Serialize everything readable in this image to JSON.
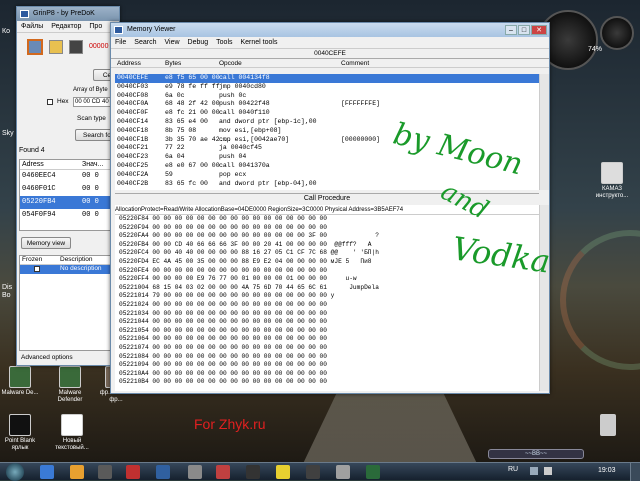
{
  "cheatengine": {
    "title": "GrinP8 - by PreDoK",
    "menu": [
      "Файлы",
      "Редактор",
      "Про"
    ],
    "value_placeholder": "00000",
    "array_label": "Array of Byte",
    "hex_label": "Hex",
    "hex_value": "00 00 CD 40",
    "scan_type_label": "Scan type",
    "found_label": "Found 4",
    "search_btn": "Search for",
    "first_btn": "Ce",
    "addr_col": "Adress",
    "val_col": "Знач...",
    "results": [
      {
        "addr": "0460EEC4",
        "val": "00 0"
      },
      {
        "addr": "0460F01C",
        "val": "00 0"
      },
      {
        "addr": "05220FB4",
        "val": "00 0"
      },
      {
        "addr": "054F0F94",
        "val": "00 0"
      }
    ],
    "memview_btn": "Memory view",
    "table_col1": "Frozen",
    "table_col2": "Description",
    "table_desc": "No description",
    "advanced": "Advanced options"
  },
  "memview": {
    "title": "Memory Viewer",
    "menu": [
      "File",
      "Search",
      "View",
      "Debug",
      "Tools",
      "Kernel tools"
    ],
    "addrbar": "0040CEFE",
    "cols": [
      "Address",
      "Bytes",
      "Opcode",
      "Comment"
    ],
    "rows": [
      {
        "a": "0040CEFE",
        "b": "e8 f5 65 00 00",
        "o": "call 004134f8",
        "c": ""
      },
      {
        "a": "0040CF03",
        "b": "e9 78 fe ff ff",
        "o": "jmp 0040cd80",
        "c": ""
      },
      {
        "a": "0040CF08",
        "b": "6a 0c",
        "o": "push 0c",
        "c": ""
      },
      {
        "a": "0040CF0A",
        "b": "68 48 2f 42 00",
        "o": "push 00422f48",
        "c": "[FFFFFFFE]"
      },
      {
        "a": "0040CF0F",
        "b": "e8 fc 21 00 00",
        "o": "call 0040f110",
        "c": ""
      },
      {
        "a": "0040CF14",
        "b": "83 65 e4 00",
        "o": "and dword ptr [ebp-1c],00",
        "c": ""
      },
      {
        "a": "0040CF18",
        "b": "8b 75 08",
        "o": "mov esi,[ebp+08]",
        "c": ""
      },
      {
        "a": "0040CF1B",
        "b": "3b 35 70 ae 42...",
        "o": "cmp esi,[0042ae70]",
        "c": "[00000000]"
      },
      {
        "a": "0040CF21",
        "b": "77 22",
        "o": "ja 0040cf45",
        "c": ""
      },
      {
        "a": "0040CF23",
        "b": "6a 04",
        "o": "push 04",
        "c": ""
      },
      {
        "a": "0040CF25",
        "b": "e8 e0 67 00 00",
        "o": "call 0041370a",
        "c": ""
      },
      {
        "a": "0040CF2A",
        "b": "59",
        "o": "pop ecx",
        "c": ""
      },
      {
        "a": "0040CF2B",
        "b": "83 65 fc 00",
        "o": "and dword ptr [ebp-04],00",
        "c": ""
      }
    ],
    "callproc": "Call Procedure",
    "hexinfo": "AllocationProtect=Read/Write AllocationBase=04DE0000 RegionSize=3C0000 Physical Address=3B5AEF74",
    "hexrows": [
      "05220F84 00 00 00 00 00 00 00 00 00 00 00 00 00 00 00 00",
      "05220F94 00 00 00 00 00 00 00 00 00 00 00 00 00 00 00 00",
      "05220FA4 00 00 00 00 00 00 00 00 00 00 00 00 00 00 3F 00             ?",
      "05220FB4 00 00 CD 40 66 66 66 3F 00 00 20 41 00 00 00 00  @@fff?   A",
      "05220FC4 00 00 40 40 00 00 00 00 88 16 27 05 C1 CF 7C 68 @@    ' 'БП|h",
      "05220FD4 EC 4A 45 00 35 00 00 00 88 E9 E2 04 00 00 00 00 мJE 5   Пи8",
      "05220FE4 00 00 00 00 00 00 00 00 00 00 00 00 00 00 00 00",
      "05220FF4 00 00 00 00 E9 76 77 00 01 00 00 00 01 00 00 00     u-w",
      "05221004 68 15 04 03 02 00 00 00 4A 75 6D 70 44 65 6C 61      JumpDela",
      "05221014 79 00 00 00 00 00 00 00 00 00 00 00 00 00 00 00 y",
      "05221024 00 00 00 00 00 00 00 00 00 00 00 00 00 00 00 00",
      "05221034 00 00 00 00 00 00 00 00 00 00 00 00 00 00 00 00",
      "05221044 00 00 00 00 00 00 00 00 00 00 00 00 00 00 00 00",
      "05221054 00 00 00 00 00 00 00 00 00 00 00 00 00 00 00 00",
      "05221064 00 00 00 00 00 00 00 00 00 00 00 00 00 00 00 00",
      "05221074 00 00 00 00 00 00 00 00 00 00 00 00 00 00 00 00",
      "05221084 00 00 00 00 00 00 00 00 00 00 00 00 00 00 00 00",
      "05221094 00 00 00 00 00 00 00 00 00 00 00 00 00 00 00 00",
      "052210A4 00 00 00 00 00 00 00 00 00 00 00 00 00 00 00 00",
      "052210B4 00 00 00 00 00 00 00 00 00 00 00 00 00 00 00 00"
    ]
  },
  "desktop": {
    "icons": [
      {
        "label": "Malware De..."
      },
      {
        "label": "Malware Defender"
      },
      {
        "label": "фр... готика фр..."
      },
      {
        "label": "Point Blank ярлык"
      },
      {
        "label": "Новый текстовый..."
      },
      {
        "label": "КАМАЗ инструкто..."
      }
    ],
    "left_labels": [
      "Ко",
      "Sky",
      "Dis",
      "Bo"
    ],
    "scribble1": "by Moon",
    "scribble2": "and",
    "scribble3": "Vodka",
    "watermark": "For Zhyk.ru",
    "gauge_pct": "74%"
  },
  "taskbar": {
    "lang": "RU",
    "time": "19:03",
    "media": "~~BB~~"
  }
}
